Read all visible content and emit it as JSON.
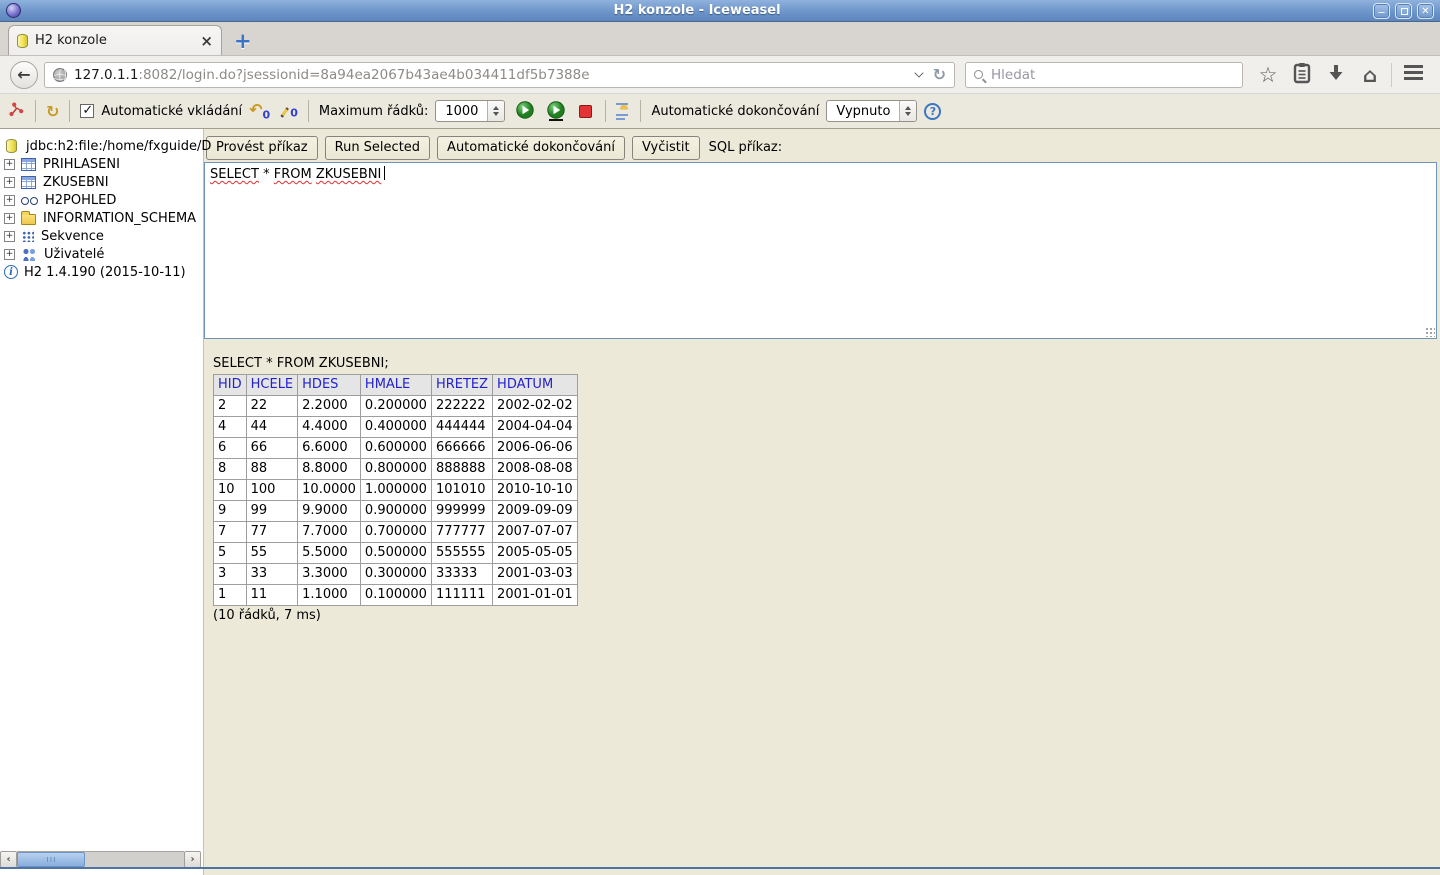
{
  "window": {
    "title": "H2 konzole - Iceweasel"
  },
  "browser": {
    "tab_title": "H2 konzole",
    "url_host": "127.0.1.1",
    "url_rest": ":8082/login.do?jsessionid=8a94ea2067b43ae4b034411df5b7388e",
    "search_placeholder": "Hledat"
  },
  "toolbar": {
    "autocommit_label": "Automatické vkládání",
    "undo_count": "0",
    "edit_count": "0",
    "max_rows_label": "Maximum řádků:",
    "max_rows_value": "1000",
    "autocomplete_label": "Automatické dokončování",
    "autocomplete_value": "Vypnuto"
  },
  "sidebar": {
    "connection": "jdbc:h2:file:/home/fxguide/D",
    "items": [
      {
        "key": "prihlaseni",
        "label": "PRIHLASENI",
        "icon": "table"
      },
      {
        "key": "zkusebni",
        "label": "ZKUSEBNI",
        "icon": "table"
      },
      {
        "key": "h2pohled",
        "label": "H2POHLED",
        "icon": "view"
      },
      {
        "key": "information-schema",
        "label": "INFORMATION_SCHEMA",
        "icon": "folder"
      },
      {
        "key": "sekvence",
        "label": "Sekvence",
        "icon": "sequence"
      },
      {
        "key": "uzivatele",
        "label": "Uživatelé",
        "icon": "users"
      }
    ],
    "version": "H2 1.4.190 (2015-10-11)"
  },
  "main": {
    "buttons": {
      "run": "Provést příkaz",
      "run_selected": "Run Selected",
      "autocomplete": "Automatické dokončování",
      "clear": "Vyčistit"
    },
    "sql_label": "SQL příkaz:",
    "sql": {
      "words": [
        {
          "t": "SELECT",
          "wavy": true
        },
        {
          "t": "*",
          "wavy": false
        },
        {
          "t": "FROM",
          "wavy": true
        },
        {
          "t": "ZKUSEBNI",
          "wavy": true
        }
      ]
    },
    "result": {
      "query": "SELECT * FROM ZKUSEBNI;",
      "columns": [
        "HID",
        "HCELE",
        "HDES",
        "HMALE",
        "HRETEZ",
        "HDATUM"
      ],
      "rows": [
        [
          "2",
          "22",
          "2.2000",
          "0.200000",
          "222222",
          "2002-02-02"
        ],
        [
          "4",
          "44",
          "4.4000",
          "0.400000",
          "444444",
          "2004-04-04"
        ],
        [
          "6",
          "66",
          "6.6000",
          "0.600000",
          "666666",
          "2006-06-06"
        ],
        [
          "8",
          "88",
          "8.8000",
          "0.800000",
          "888888",
          "2008-08-08"
        ],
        [
          "10",
          "100",
          "10.0000",
          "1.000000",
          "101010",
          "2010-10-10"
        ],
        [
          "9",
          "99",
          "9.9000",
          "0.900000",
          "999999",
          "2009-09-09"
        ],
        [
          "7",
          "77",
          "7.7000",
          "0.700000",
          "777777",
          "2007-07-07"
        ],
        [
          "5",
          "55",
          "5.5000",
          "0.500000",
          "555555",
          "2005-05-05"
        ],
        [
          "3",
          "33",
          "3.3000",
          "0.300000",
          "33333",
          "2001-03-03"
        ],
        [
          "1",
          "11",
          "1.1000",
          "0.100000",
          "111111",
          "2001-01-01"
        ]
      ],
      "status": "(10 řádků, 7 ms)"
    }
  },
  "colors": {
    "titlebar_blue": "#6b93c8",
    "main_beige": "#ece9d8",
    "header_link_blue": "#2222cc",
    "squiggle_red": "#e03030",
    "scroll_thumb_blue": "#88aede"
  }
}
